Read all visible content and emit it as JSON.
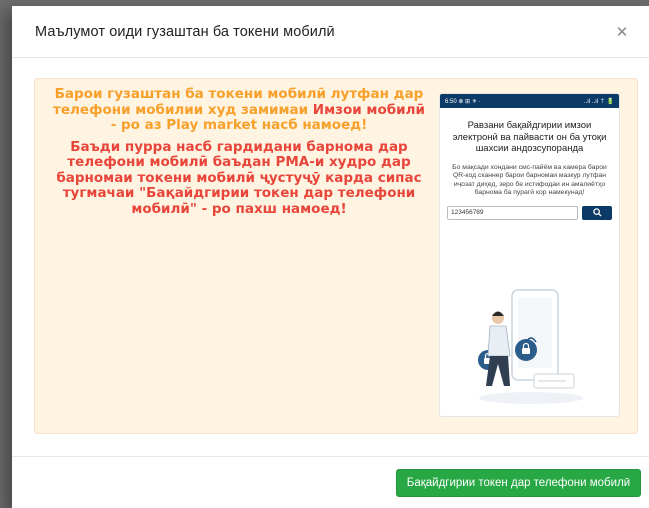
{
  "modal": {
    "title": "Маълумот оиди гузаштан ба токени мобилӣ",
    "close_icon": "close-icon"
  },
  "info": {
    "p1_part1": "Барои гузаштан ба токени мобилӣ лутфан дар телефони мобилии худ замимаи ",
    "p1_highlight": "Имзои мобилӣ",
    "p1_part2": " - ро аз Play market насб намоед!",
    "p2": "Баъди пурра насб гардидани барнома дар телефони мобилӣ баъдан РМА-и худро дар барномаи токени мобилӣ ҷустуҷӯ карда сипас тугмачаи \"Бақайдгирии токен дар телефони мобилӣ\" - ро пахш намоед!",
    "colors": {
      "orange": "#f7a02a",
      "red": "#e8463a",
      "box_bg": "#fff3e2"
    }
  },
  "phone": {
    "status_time": "6:50 ⊗ ⊞ ☀ ·",
    "status_right": "..ıl ..ıl ⇡ 🔋",
    "title": "Равзани бақайдгирии имзои электронӣ ва пайвасти он ба утоқи шахсии андозсупоранда",
    "description": "Бо мақсади хондани смс-пайём ва камера барои QR-код сканнер барои барномаи мазкур лутфан иҷозат диҳед, зеро бе истифодаи ин амалиётҳо барнома ба пурагӣ кор намекунад!",
    "search_value": "123456789",
    "search_icon": "search-icon",
    "accent": "#0c3a66"
  },
  "footer": {
    "register_button": "Бақайдгирии токен дар телефони мобилӣ",
    "button_color": "#28a745"
  }
}
